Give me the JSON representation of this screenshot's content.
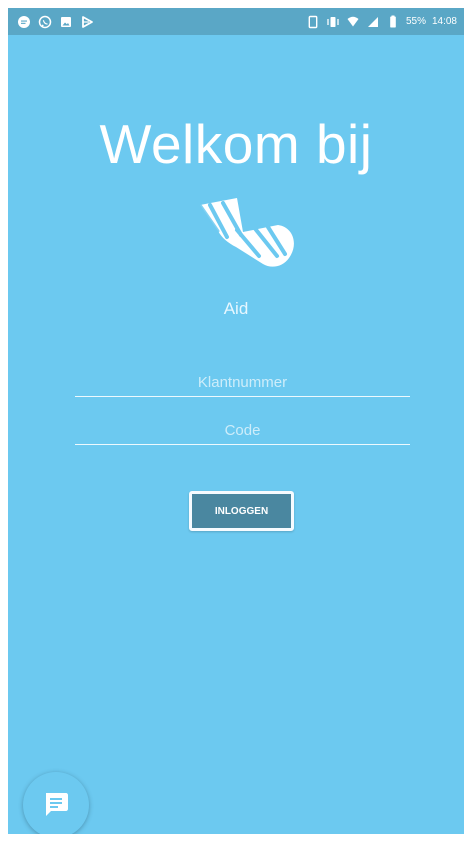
{
  "status_bar": {
    "left_icons": [
      "message-icon",
      "whatsapp-icon",
      "gallery-icon",
      "play-store-icon"
    ],
    "right_icons": [
      "phone-icon",
      "vibrate-icon",
      "wifi-icon",
      "signal-icon",
      "battery-icon"
    ],
    "battery": "55%",
    "time": "14:08"
  },
  "welcome": {
    "title": "Welkom bij",
    "brand": "Aid",
    "logo_icon": "sock-icon"
  },
  "login_form": {
    "customer_number_placeholder": "Klantnummer",
    "code_placeholder": "Code",
    "login_button": "INLOGGEN"
  },
  "chat": {
    "icon": "chat-icon"
  },
  "colors": {
    "background": "#6cc9f0",
    "status_bar": "#5aa7c6",
    "button": "#4a87a0",
    "text": "#ffffff"
  }
}
